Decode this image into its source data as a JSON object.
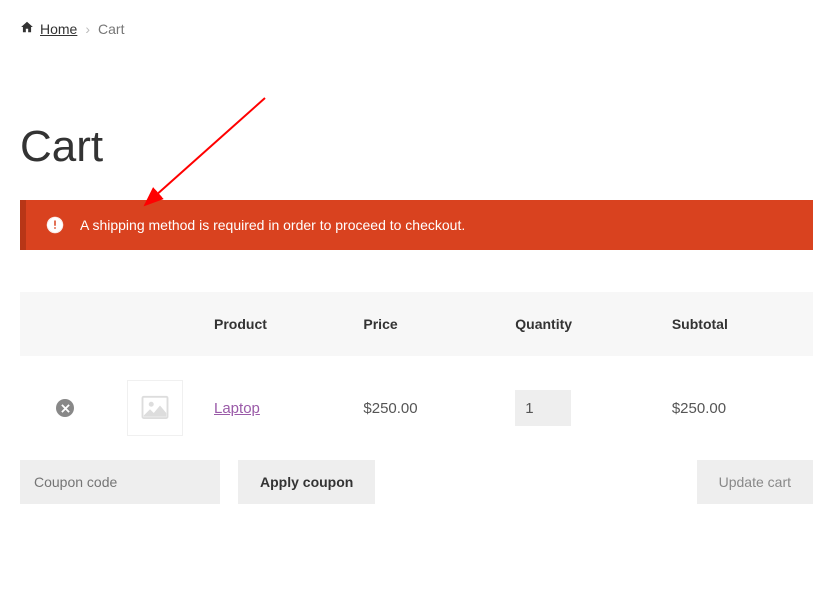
{
  "breadcrumb": {
    "home_label": "Home",
    "current_label": "Cart",
    "separator": "›"
  },
  "page": {
    "title": "Cart"
  },
  "alert": {
    "message": "A shipping method is required in order to proceed to checkout."
  },
  "table": {
    "headers": {
      "product": "Product",
      "price": "Price",
      "quantity": "Quantity",
      "subtotal": "Subtotal"
    },
    "rows": [
      {
        "product_name": "Laptop",
        "price": "$250.00",
        "quantity": "1",
        "subtotal": "$250.00"
      }
    ]
  },
  "coupon": {
    "placeholder": "Coupon code",
    "apply_label": "Apply coupon"
  },
  "update_cart_label": "Update cart",
  "colors": {
    "alert_bg": "#d9421f",
    "alert_border": "#b83617",
    "link": "#9a5aa8"
  }
}
